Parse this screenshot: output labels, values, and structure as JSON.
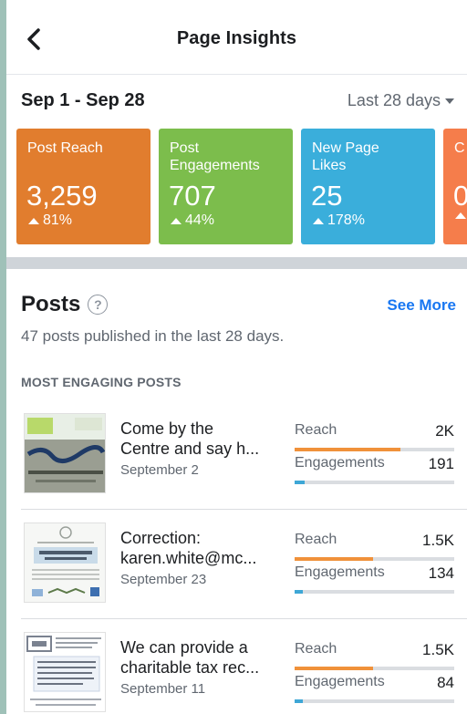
{
  "header": {
    "title": "Page Insights"
  },
  "range": {
    "dates": "Sep 1 - Sep 28",
    "selected": "Last 28 days"
  },
  "cards": [
    {
      "label": "Post Reach",
      "value": "3,259",
      "change": "81%",
      "color": "#e17d2e"
    },
    {
      "label": "Post Engagements",
      "value": "707",
      "change": "44%",
      "color": "#7cbd4c"
    },
    {
      "label": "New Page Likes",
      "value": "25",
      "change": "178%",
      "color": "#3aaedb"
    },
    {
      "label": "C",
      "value": "0",
      "change": "",
      "color": "#f57d4b"
    }
  ],
  "posts": {
    "title": "Posts",
    "help_symbol": "?",
    "see_more": "See More",
    "subtitle": "47 posts published in the last 28 days.",
    "section_label": "MOST ENGAGING POSTS",
    "reach_label": "Reach",
    "engagements_label": "Engagements",
    "reach_color": "#f0913a",
    "engagements_color": "#3ea7d6",
    "items": [
      {
        "line1": "Come by the",
        "line2": "Centre and say h...",
        "date": "September 2",
        "reach": "2K",
        "engagements": "191",
        "reach_fraction": 0.66,
        "engagements_fraction": 0.06
      },
      {
        "line1": "Correction:",
        "line2": "karen.white@mc...",
        "date": "September 23",
        "reach": "1.5K",
        "engagements": "134",
        "reach_fraction": 0.49,
        "engagements_fraction": 0.04
      },
      {
        "line1": "We can provide a",
        "line2": "charitable tax rec...",
        "date": "September 11",
        "reach": "1.5K",
        "engagements": "84",
        "reach_fraction": 0.49,
        "engagements_fraction": 0.03
      }
    ]
  }
}
